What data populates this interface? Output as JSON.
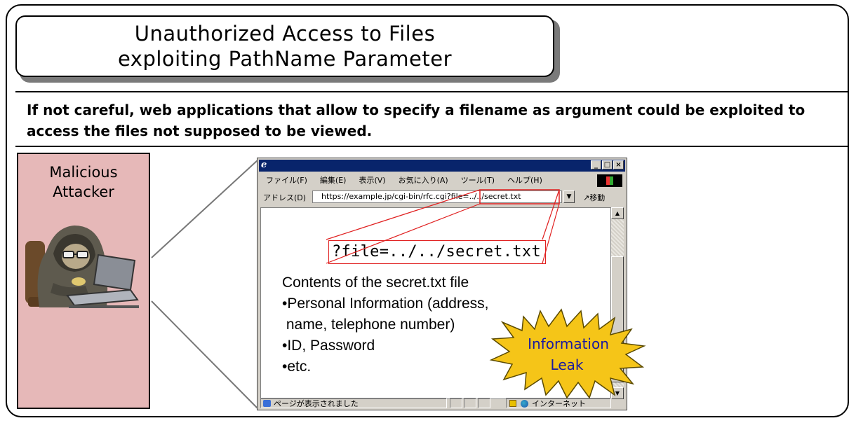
{
  "title": {
    "line1": "Unauthorized Access to Files",
    "line2": "exploiting PathName Parameter"
  },
  "description": {
    "line1": "If not careful, web applications that allow to specify a filename as argument could be exploited to",
    "line2": "access the files not supposed to be viewed."
  },
  "attacker": {
    "label_line1": "Malicious",
    "label_line2": "Attacker"
  },
  "browser": {
    "menu": [
      "ファイル(F)",
      "編集(E)",
      "表示(V)",
      "お気に入り(A)",
      "ツール(T)",
      "ヘルプ(H)"
    ],
    "address_label": "アドレス(D)",
    "address_value": "https://example.jp/cgi-bin/rfc.cgi?file=../../secret.txt",
    "go_label": "移動",
    "status_text": "ページが表示されました",
    "zone_text": "インターネット"
  },
  "content": {
    "parameter": "?file=../../secret.txt",
    "heading": "Contents of the secret.txt file",
    "items": [
      "•Personal Information (address,",
      " name, telephone number)",
      "•ID, Password",
      "•etc."
    ]
  },
  "callout": {
    "line1": "Information",
    "line2": "Leak"
  },
  "colors": {
    "attacker_bg": "#e6b8b8",
    "highlight": "#e02020",
    "burst_fill": "#f5c518",
    "burst_text": "#1a1aa0"
  }
}
